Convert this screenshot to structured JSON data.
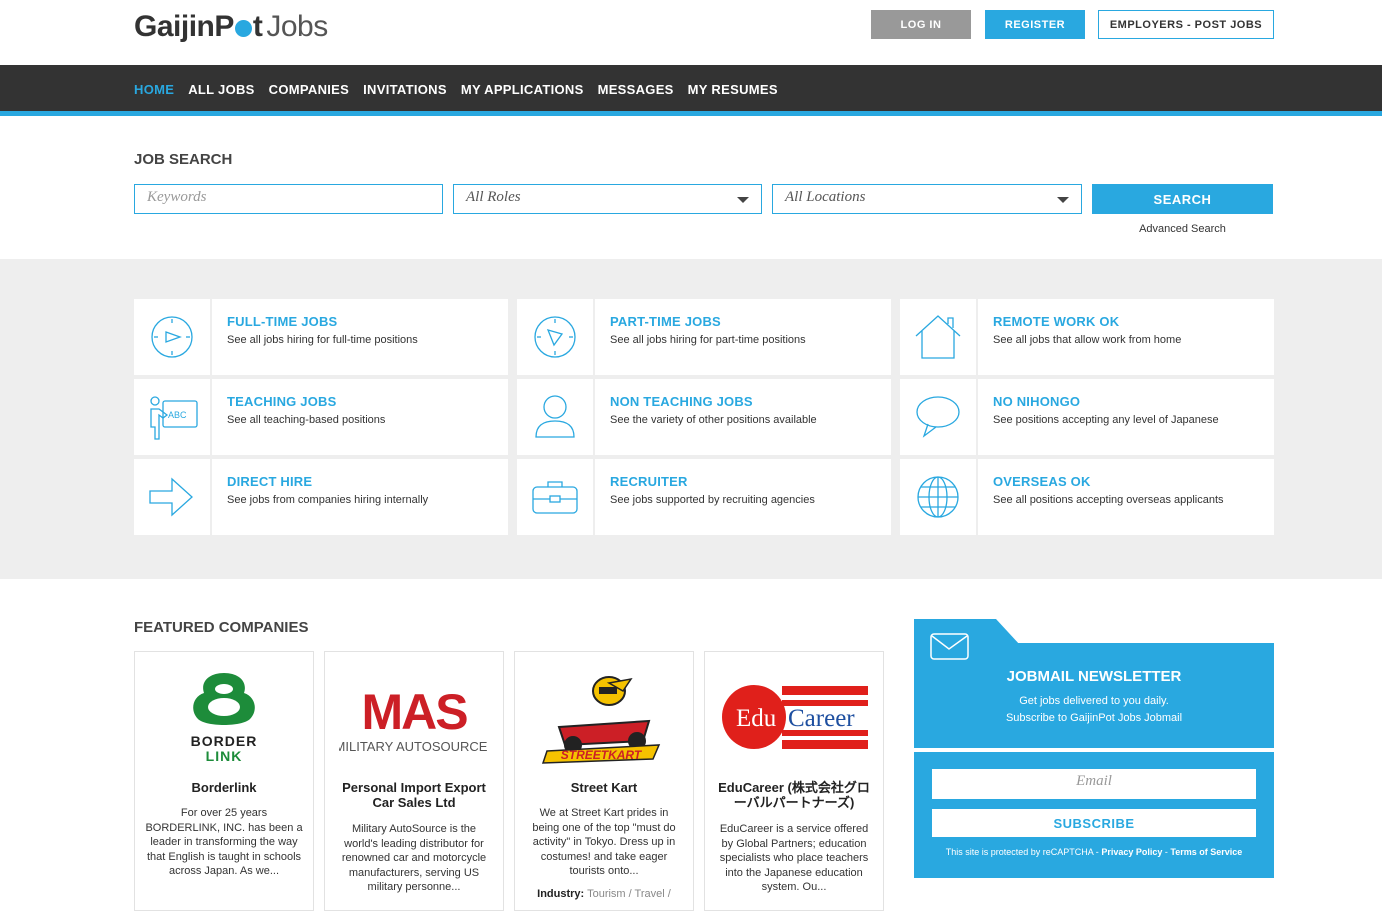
{
  "header": {
    "logo_main": "GaijinP",
    "logo_after_dot": "t",
    "logo_light": "Jobs",
    "login": "LOG IN",
    "register": "REGISTER",
    "employers": "EMPLOYERS - POST JOBS"
  },
  "nav": {
    "items": [
      "HOME",
      "ALL JOBS",
      "COMPANIES",
      "INVITATIONS",
      "MY APPLICATIONS",
      "MESSAGES",
      "MY RESUMES"
    ],
    "active": "HOME"
  },
  "search": {
    "title": "JOB SEARCH",
    "keywords_placeholder": "Keywords",
    "roles_value": "All Roles",
    "locations_value": "All Locations",
    "button": "SEARCH",
    "advanced": "Advanced Search"
  },
  "categories": [
    {
      "icon": "clock-full-icon",
      "title": "FULL-TIME JOBS",
      "desc": "See all jobs hiring for full-time positions"
    },
    {
      "icon": "clock-part-icon",
      "title": "PART-TIME JOBS",
      "desc": "See all jobs hiring for part-time positions"
    },
    {
      "icon": "house-icon",
      "title": "REMOTE WORK OK",
      "desc": "See all jobs that allow work from home"
    },
    {
      "icon": "teacher-board-icon",
      "title": "TEACHING JOBS",
      "desc": "See all teaching-based positions"
    },
    {
      "icon": "person-icon",
      "title": "NON TEACHING JOBS",
      "desc": "See the variety of other positions available"
    },
    {
      "icon": "speech-bubble-icon",
      "title": "NO NIHONGO",
      "desc": "See positions accepting any level of Japanese"
    },
    {
      "icon": "arrow-right-icon",
      "title": "DIRECT HIRE",
      "desc": "See jobs from companies hiring internally"
    },
    {
      "icon": "briefcase-icon",
      "title": "RECRUITER",
      "desc": "See jobs supported by recruiting agencies"
    },
    {
      "icon": "globe-icon",
      "title": "OVERSEAS OK",
      "desc": "See all positions accepting overseas applicants"
    }
  ],
  "featured": {
    "title": "FEATURED COMPANIES",
    "companies": [
      {
        "logo_text": [
          "BORDER",
          "LINK"
        ],
        "name": "Borderlink",
        "desc": "For over 25 years BORDERLINK, INC. has been a leader in transforming the way that English is taught in schools across Japan. As we..."
      },
      {
        "logo_text": [
          "MAS",
          "MILITARY AUTOSOURCE"
        ],
        "name": "Personal Import Export Car Sales Ltd",
        "desc": "Military AutoSource is the world's leading distributor for renowned car and motorcycle manufacturers, serving US military personne..."
      },
      {
        "logo_text": [
          "STREETKART"
        ],
        "name": "Street Kart",
        "desc": "We at Street Kart prides in being one of the top \"must do activity\" in Tokyo. Dress up in costumes! and take eager tourists onto...",
        "industry_label": "Industry:",
        "industry_value": "Tourism / Travel /"
      },
      {
        "logo_text": [
          "Edu",
          "Career"
        ],
        "name": "EduCareer (株式会社グローバルパートナーズ)",
        "desc": "EduCareer is a service offered by Global Partners; education specialists who place teachers into the Japanese education system. Ou..."
      }
    ]
  },
  "newsletter": {
    "title": "JOBMAIL NEWSLETTER",
    "line1": "Get jobs delivered to you daily.",
    "line2": "Subscribe to GaijinPot Jobs Jobmail",
    "email_placeholder": "Email",
    "subscribe": "SUBSCRIBE",
    "legal_prefix": "This site is protected by reCAPTCHA - ",
    "privacy": "Privacy Policy",
    "sep": " - ",
    "terms": "Terms of Service"
  },
  "colors": {
    "accent": "#29a8e0",
    "nav_bg": "#333333",
    "band_bg": "#eeeeee"
  }
}
